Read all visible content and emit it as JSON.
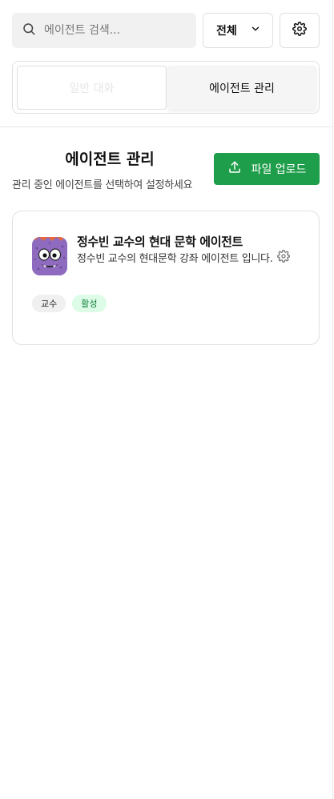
{
  "search": {
    "placeholder": "에이전트 검색..."
  },
  "filter": {
    "selected": "전체"
  },
  "tabs": [
    {
      "label": "일반 대화"
    },
    {
      "label": "에이전트 관리"
    }
  ],
  "section": {
    "title": "에이전트 관리",
    "subtitle": "관리 중인 에이전트를 선택하여 설정하세요",
    "upload_label": "파일 업로드"
  },
  "agents": [
    {
      "name": "정수빈 교수의 현대 문학 에이전트",
      "description": "정수빈 교수의 현대문학 강좌 에이전트 입니다.",
      "role_badge": "교수",
      "status_badge": "활성"
    }
  ],
  "colors": {
    "accent": "#1e9e4a",
    "status_active_bg": "#dcfce7",
    "status_active_text": "#15803d",
    "avatar": "#8e6bbf"
  }
}
